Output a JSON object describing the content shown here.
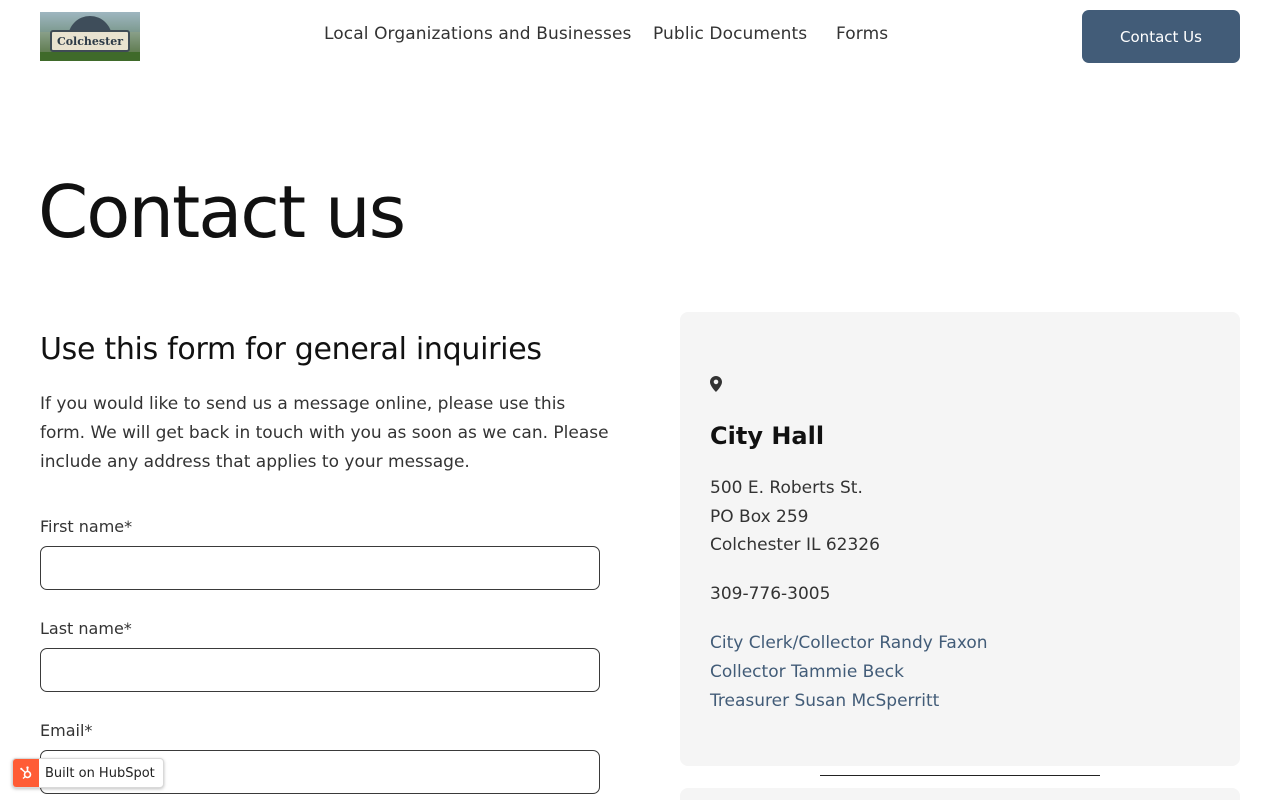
{
  "header": {
    "logo_text": "Colchester",
    "nav": [
      {
        "label": "Local Organizations and Businesses"
      },
      {
        "label": "Public Documents"
      },
      {
        "label": "Forms"
      }
    ],
    "cta_label": "Contact Us"
  },
  "page": {
    "title": "Contact us"
  },
  "form": {
    "heading": "Use this form for general inquiries",
    "intro": "If you would like to send us a message online, please use this form. We will get back in touch with you as soon as we can. Please include any address that applies to your message.",
    "fields": [
      {
        "label": "First name*",
        "value": "",
        "placeholder": ""
      },
      {
        "label": "Last name*",
        "value": "",
        "placeholder": ""
      },
      {
        "label": "Email*",
        "value": "",
        "placeholder": ""
      }
    ]
  },
  "info_card": {
    "icon": "map-pin-icon",
    "title": "City Hall",
    "address": [
      "500 E. Roberts St.",
      "PO Box 259",
      "Colchester IL 62326"
    ],
    "phone": "309-776-3005",
    "staff": [
      "City Clerk/Collector Randy Faxon",
      "Collector Tammie Beck",
      "Treasurer Susan McSperritt"
    ]
  },
  "badge": {
    "label": "Built on HubSpot",
    "icon": "hubspot-sprocket-icon"
  },
  "colors": {
    "accent": "#425c78",
    "card_bg": "#f5f5f5",
    "hubspot": "#ff5c35"
  }
}
